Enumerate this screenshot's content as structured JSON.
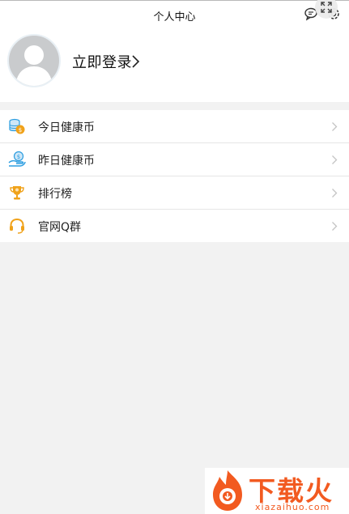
{
  "header": {
    "title": "个人中心",
    "icons": [
      "message-icon",
      "settings-icon",
      "expand-icon"
    ]
  },
  "profile": {
    "login_text": "立即登录",
    "avatar": "default-avatar"
  },
  "menu": {
    "items": [
      {
        "label": "今日健康币",
        "icon": "coins-stack-icon"
      },
      {
        "label": "昨日健康币",
        "icon": "coin-hand-icon"
      },
      {
        "label": "排行榜",
        "icon": "trophy-icon"
      },
      {
        "label": "官网Q群",
        "icon": "headset-icon"
      }
    ]
  },
  "watermark": {
    "brand": "下载火",
    "site": "xiazaihuo.com"
  },
  "colors": {
    "accent_blue": "#2b9de0",
    "accent_orange": "#f0a21a",
    "watermark_orange": "#f25a20"
  }
}
